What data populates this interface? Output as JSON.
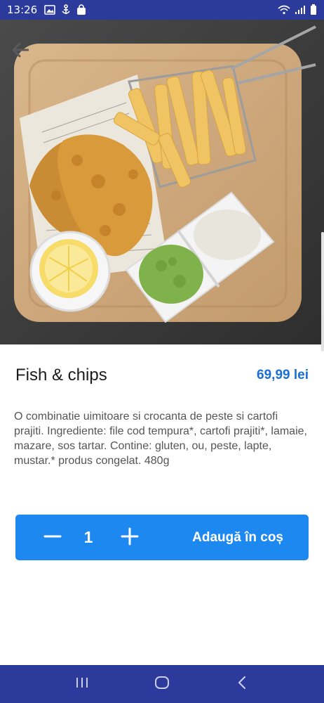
{
  "status_bar": {
    "time": "13:26",
    "icons": [
      "image-icon",
      "anchor-icon",
      "bag-icon",
      "wifi-icon",
      "signal-icon",
      "battery-icon"
    ]
  },
  "hero": {
    "icon": "back-arrow-icon"
  },
  "product": {
    "name": "Fish & chips",
    "price": "69,99 lei",
    "description": "O combinatie uimitoare si crocanta de peste si cartofi prajiti. Ingrediente: file cod tempura*, cartofi prajiti*, lamaie, mazare, sos tartar. Contine: gluten, ou, peste, lapte, mustar.* produs congelat. 480g"
  },
  "cart": {
    "quantity": "1",
    "add_label": "Adaugă în coș",
    "minus_icon": "minus-icon",
    "plus_icon": "plus-icon"
  },
  "nav_bar": {
    "icons": [
      "recent-apps-icon",
      "home-icon",
      "back-icon"
    ]
  },
  "colors": {
    "system_bar": "#2b3a9b",
    "accent": "#1e88f1",
    "price": "#1a6fd4"
  }
}
